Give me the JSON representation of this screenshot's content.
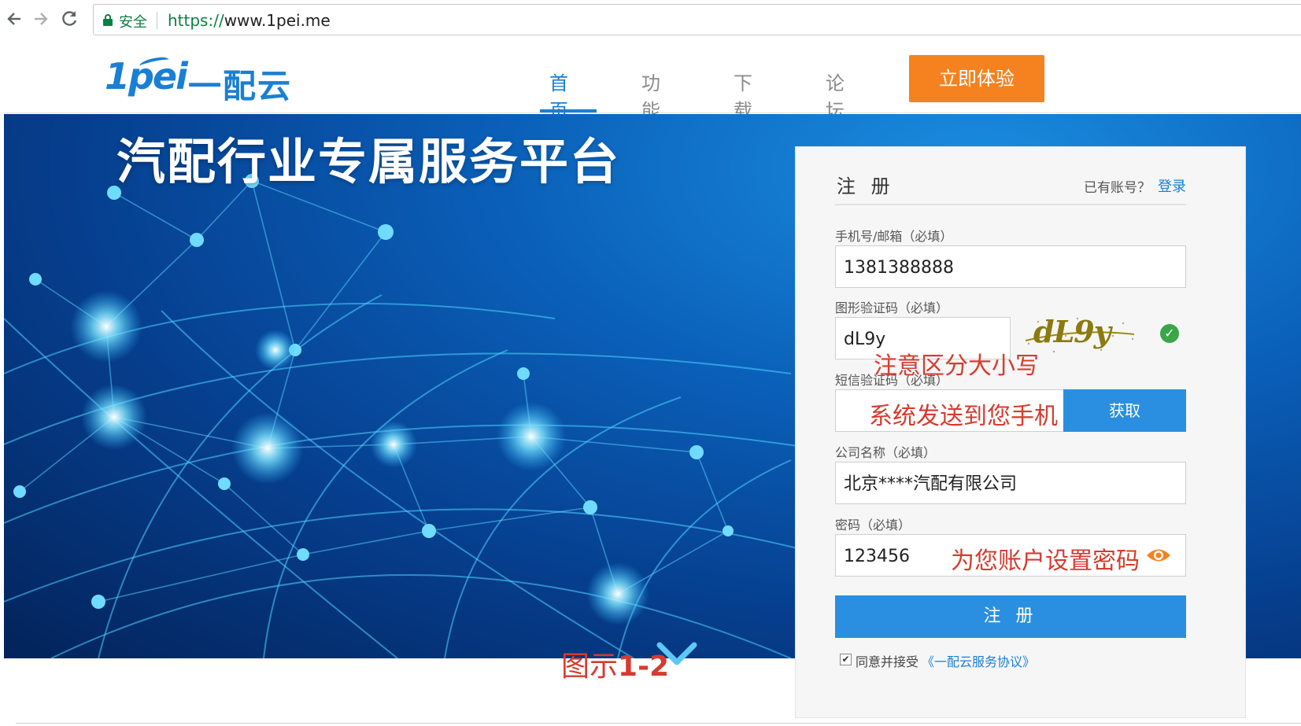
{
  "browser": {
    "secure_label": "安全",
    "url_scheme": "https://",
    "url_rest": "www.1pei.me",
    "icons": [
      "back-arrow-icon",
      "forward-arrow-icon",
      "reload-icon",
      "lock-icon"
    ]
  },
  "header": {
    "logo_mark": "1pei",
    "logo_name": "一配云",
    "nav": [
      {
        "label": "首页",
        "active": true
      },
      {
        "label": "功能",
        "active": false
      },
      {
        "label": "下载",
        "active": false
      },
      {
        "label": "论坛",
        "active": false
      }
    ],
    "cta_label": "立即体验",
    "brand_color": "#1a7fd4",
    "cta_color": "#f5821f"
  },
  "hero": {
    "title": "汽配行业专属服务平台"
  },
  "register": {
    "title": "注 册",
    "have_account": "已有账号？",
    "login_link": "登录",
    "fields": {
      "phone": {
        "label": "手机号/邮箱（必填）",
        "value": "1381388888"
      },
      "captcha": {
        "label": "图形验证码（必填）",
        "value": "dL9y",
        "image_text": "dL9y"
      },
      "sms": {
        "label": "短信验证码（必填）",
        "value": "",
        "button_label": "获取"
      },
      "company": {
        "label": "公司名称（必填）",
        "value": "北京****汽配有限公司"
      },
      "password": {
        "label": "密码（必填）",
        "value": "123456"
      }
    },
    "submit_label": "注 册",
    "agree_text": "同意并接受",
    "agree_link": "《一配云服务协议》",
    "agree_checked": true,
    "button_color": "#2a8fe0"
  },
  "annotations": {
    "captcha_note": "注意区分大小写",
    "sms_note": "系统发送到您手机",
    "password_note": "为您账户设置密码",
    "figure_caption_prefix": "图示",
    "figure_caption_number": "1-2",
    "color": "#d63b2f"
  }
}
